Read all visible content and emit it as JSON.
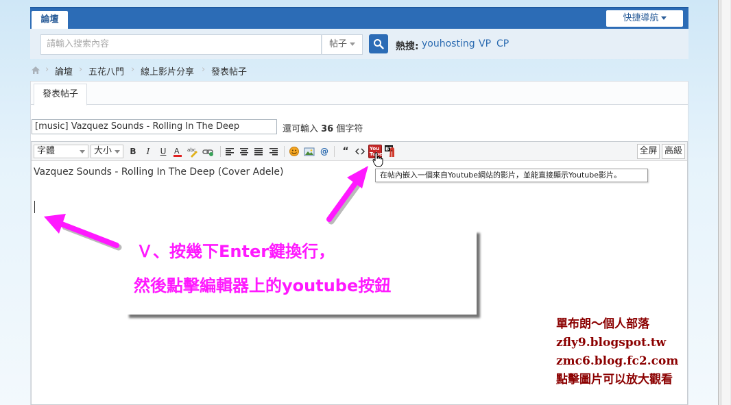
{
  "nav": {
    "forum_tab": "論壇",
    "quick_nav": "快捷導航"
  },
  "search": {
    "placeholder": "請輸入搜索內容",
    "type": "帖子",
    "hot_label": "熱搜:",
    "hot_links": [
      "youhosting",
      "VP",
      "CP"
    ]
  },
  "breadcrumb": [
    "論壇",
    "五花八門",
    "線上影片分享",
    "發表帖子"
  ],
  "tabs": {
    "post_tab": "發表帖子"
  },
  "compose": {
    "title_value": "[music] Vazquez Sounds - Rolling In The Deep",
    "remaining_prefix": "還可輸入 ",
    "remaining_count": "36",
    "remaining_suffix": " 個字符",
    "font_select": "字體",
    "size_select": "大小",
    "fullscreen_label": "全屏",
    "advanced_label": "高級",
    "body_text": "Vazquez Sounds - Rolling In The Deep (Cover Adele)",
    "youtube_button_text": "You Tube"
  },
  "tooltip": {
    "youtube_button": "在帖內嵌入一個來自Youtube網站的影片，並能直接顯示Youtube影片。"
  },
  "annotation": {
    "line1": "Ｖ、按幾下Enter鍵換行，",
    "line2": "然後點擊編輯器上的youtube按鈕",
    "color": "#ff19ff"
  },
  "watermark": {
    "lines": [
      "單布朗～個人部落",
      "zfly9.blogspot.tw",
      "zmc6.blog.fc2.com",
      "點擊圖片可以放大觀看"
    ],
    "color": "#8b0000"
  }
}
